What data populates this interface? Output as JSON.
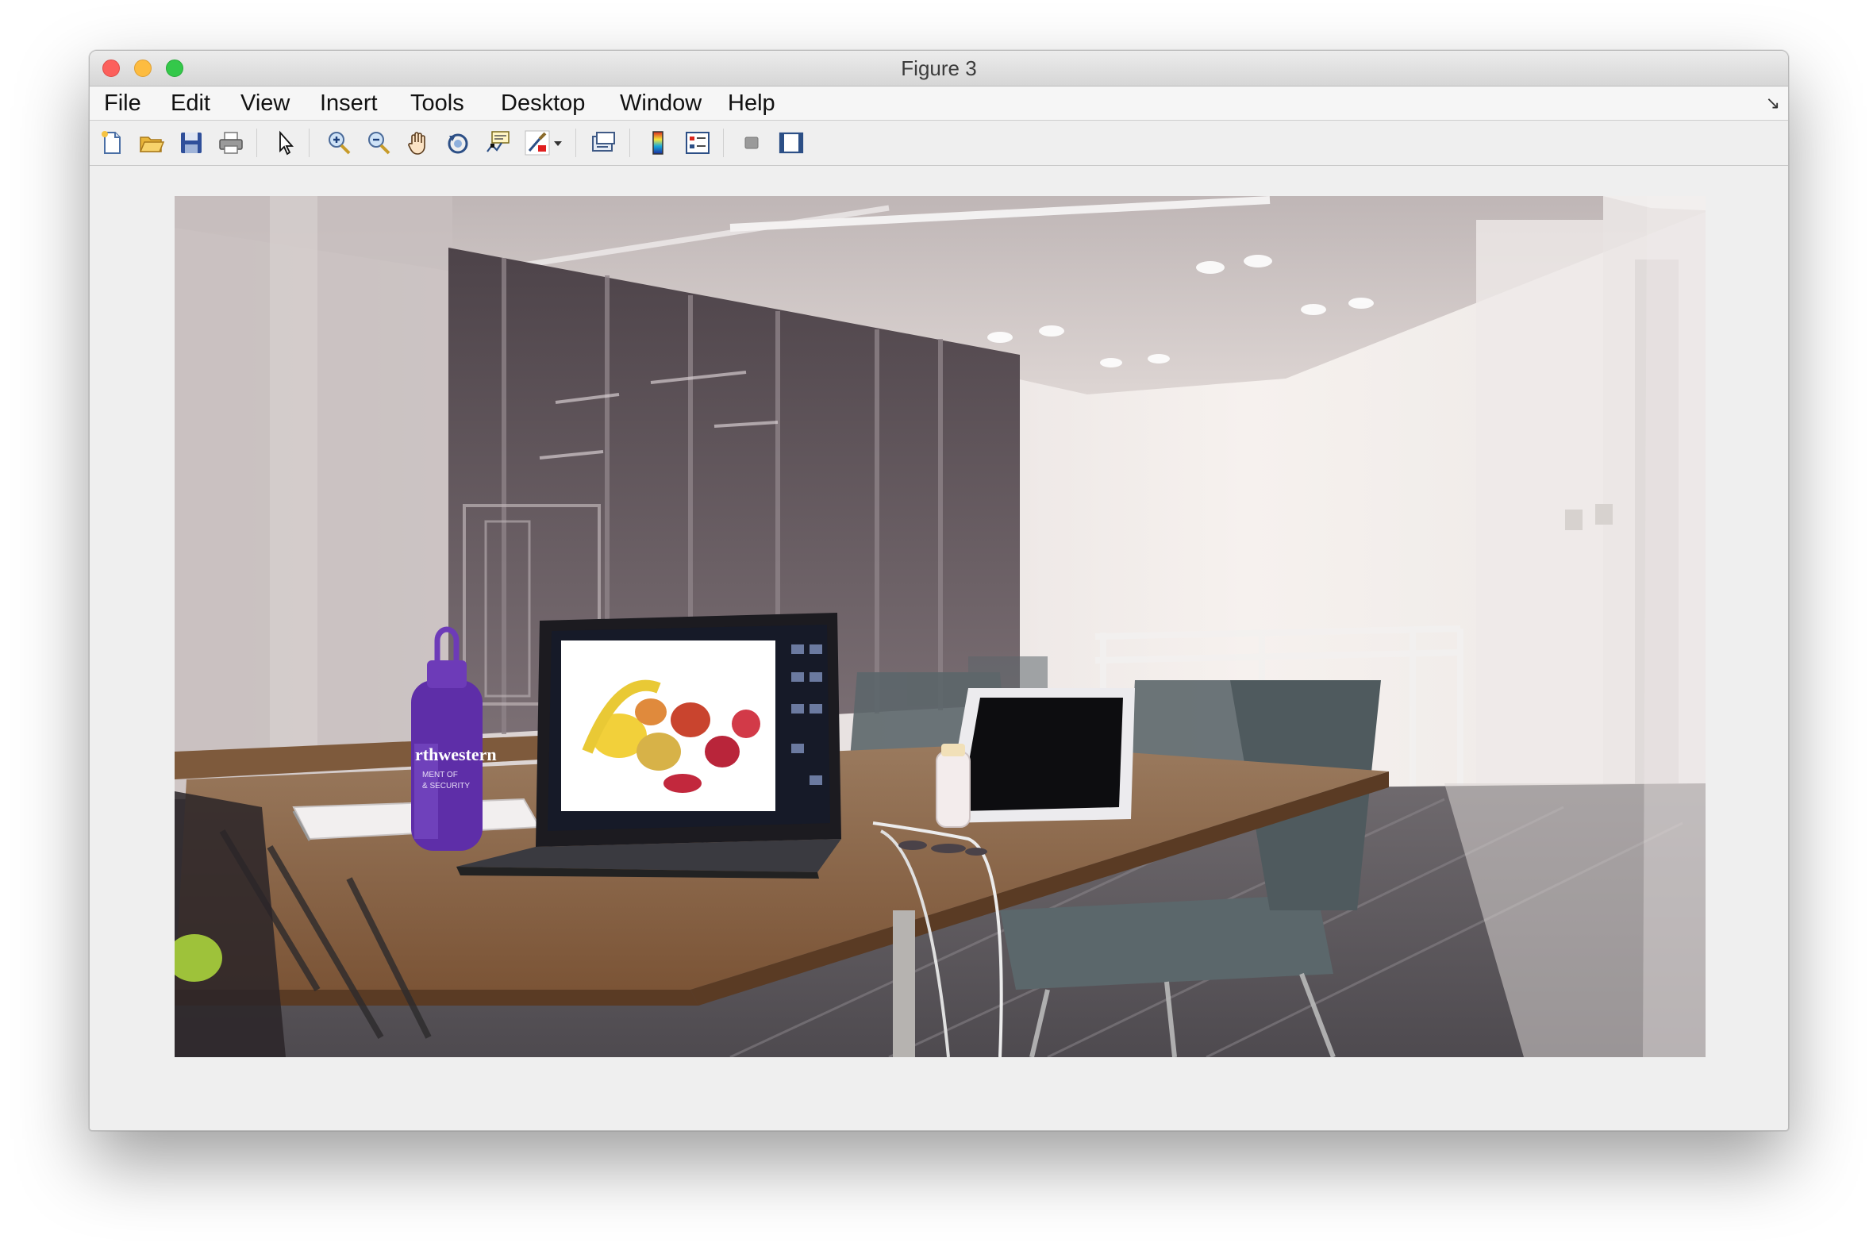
{
  "window": {
    "title": "Figure 3"
  },
  "menubar": {
    "items": [
      {
        "label": "File"
      },
      {
        "label": "Edit"
      },
      {
        "label": "View"
      },
      {
        "label": "Insert"
      },
      {
        "label": "Tools"
      },
      {
        "label": "Desktop"
      },
      {
        "label": "Window"
      },
      {
        "label": "Help"
      }
    ],
    "undock_glyph": "↘"
  },
  "toolbar": {
    "tools": [
      {
        "name": "new-figure",
        "icon": "new-figure-icon"
      },
      {
        "name": "open-file",
        "icon": "open-folder-icon"
      },
      {
        "name": "save-figure",
        "icon": "save-icon"
      },
      {
        "name": "print-figure",
        "icon": "print-icon"
      },
      {
        "name": "edit-plot",
        "icon": "pointer-arrow-icon"
      },
      {
        "name": "zoom-in",
        "icon": "zoom-in-icon"
      },
      {
        "name": "zoom-out",
        "icon": "zoom-out-icon"
      },
      {
        "name": "pan",
        "icon": "hand-pan-icon"
      },
      {
        "name": "rotate-3d",
        "icon": "rotate-3d-icon"
      },
      {
        "name": "data-cursor",
        "icon": "data-cursor-icon"
      },
      {
        "name": "brush",
        "icon": "brush-icon"
      },
      {
        "name": "brush-dropdown",
        "icon": "dropdown-arrow-icon"
      },
      {
        "name": "link-plot",
        "icon": "link-plot-icon"
      },
      {
        "name": "insert-colorbar",
        "icon": "colorbar-icon"
      },
      {
        "name": "insert-legend",
        "icon": "legend-icon"
      },
      {
        "name": "hide-plot-tools",
        "icon": "hide-plot-tools-icon"
      },
      {
        "name": "show-plot-tools",
        "icon": "show-plot-tools-icon"
      }
    ]
  },
  "image_content": {
    "description_icon": "stitched-panorama-photo",
    "bottle_text_line1": "rthwestern",
    "bottle_text_line2": "MENT OF",
    "bottle_text_line3": "& SECURITY"
  },
  "colors": {
    "close": "#fc605c",
    "minimize": "#fdbc40",
    "maximize": "#34c84a",
    "figure_bg": "#efefef"
  }
}
